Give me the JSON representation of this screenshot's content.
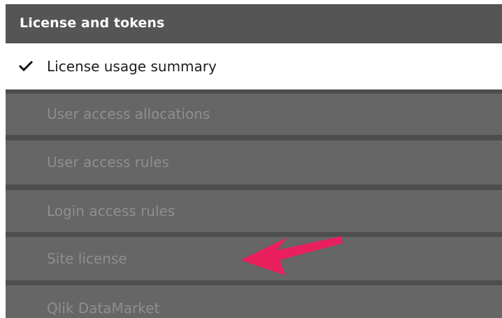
{
  "panel": {
    "title": "License and tokens",
    "items": [
      {
        "label": "License usage summary",
        "state": "active",
        "icon": "checkmark-icon"
      },
      {
        "label": "User access allocations",
        "state": "disabled"
      },
      {
        "label": "User access rules",
        "state": "disabled"
      },
      {
        "label": "Login access rules",
        "state": "disabled"
      },
      {
        "label": "Site license",
        "state": "disabled"
      },
      {
        "label": "Qlik DataMarket",
        "state": "disabled"
      }
    ]
  },
  "annotation": {
    "icon": "arrow-annotation",
    "color": "#ea1f5d",
    "points_to": "Site license"
  },
  "colors": {
    "header_bg": "#555555",
    "active_bg": "#ffffff",
    "disabled_bg": "#666666",
    "disabled_text": "#8e8e8e",
    "separator": "#4e4e4e"
  }
}
